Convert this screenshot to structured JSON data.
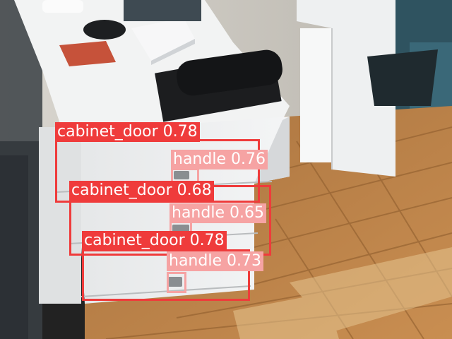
{
  "colors": {
    "cabinet_door": "#ef3b3b",
    "handle": "#f6a3a3",
    "label_text": "#ffffff"
  },
  "detections": [
    {
      "name": "cabinet-door-detection-1",
      "cls": "cabinet_door",
      "label": "cabinet_door 0.78"
    },
    {
      "name": "handle-detection-1",
      "cls": "handle",
      "label": "handle 0.76"
    },
    {
      "name": "cabinet-door-detection-2",
      "cls": "cabinet_door",
      "label": "cabinet_door 0.68"
    },
    {
      "name": "handle-detection-2",
      "cls": "handle",
      "label": "handle 0.65"
    },
    {
      "name": "cabinet-door-detection-3",
      "cls": "cabinet_door",
      "label": "cabinet_door 0.78"
    },
    {
      "name": "handle-detection-3",
      "cls": "handle",
      "label": "handle 0.73"
    }
  ]
}
